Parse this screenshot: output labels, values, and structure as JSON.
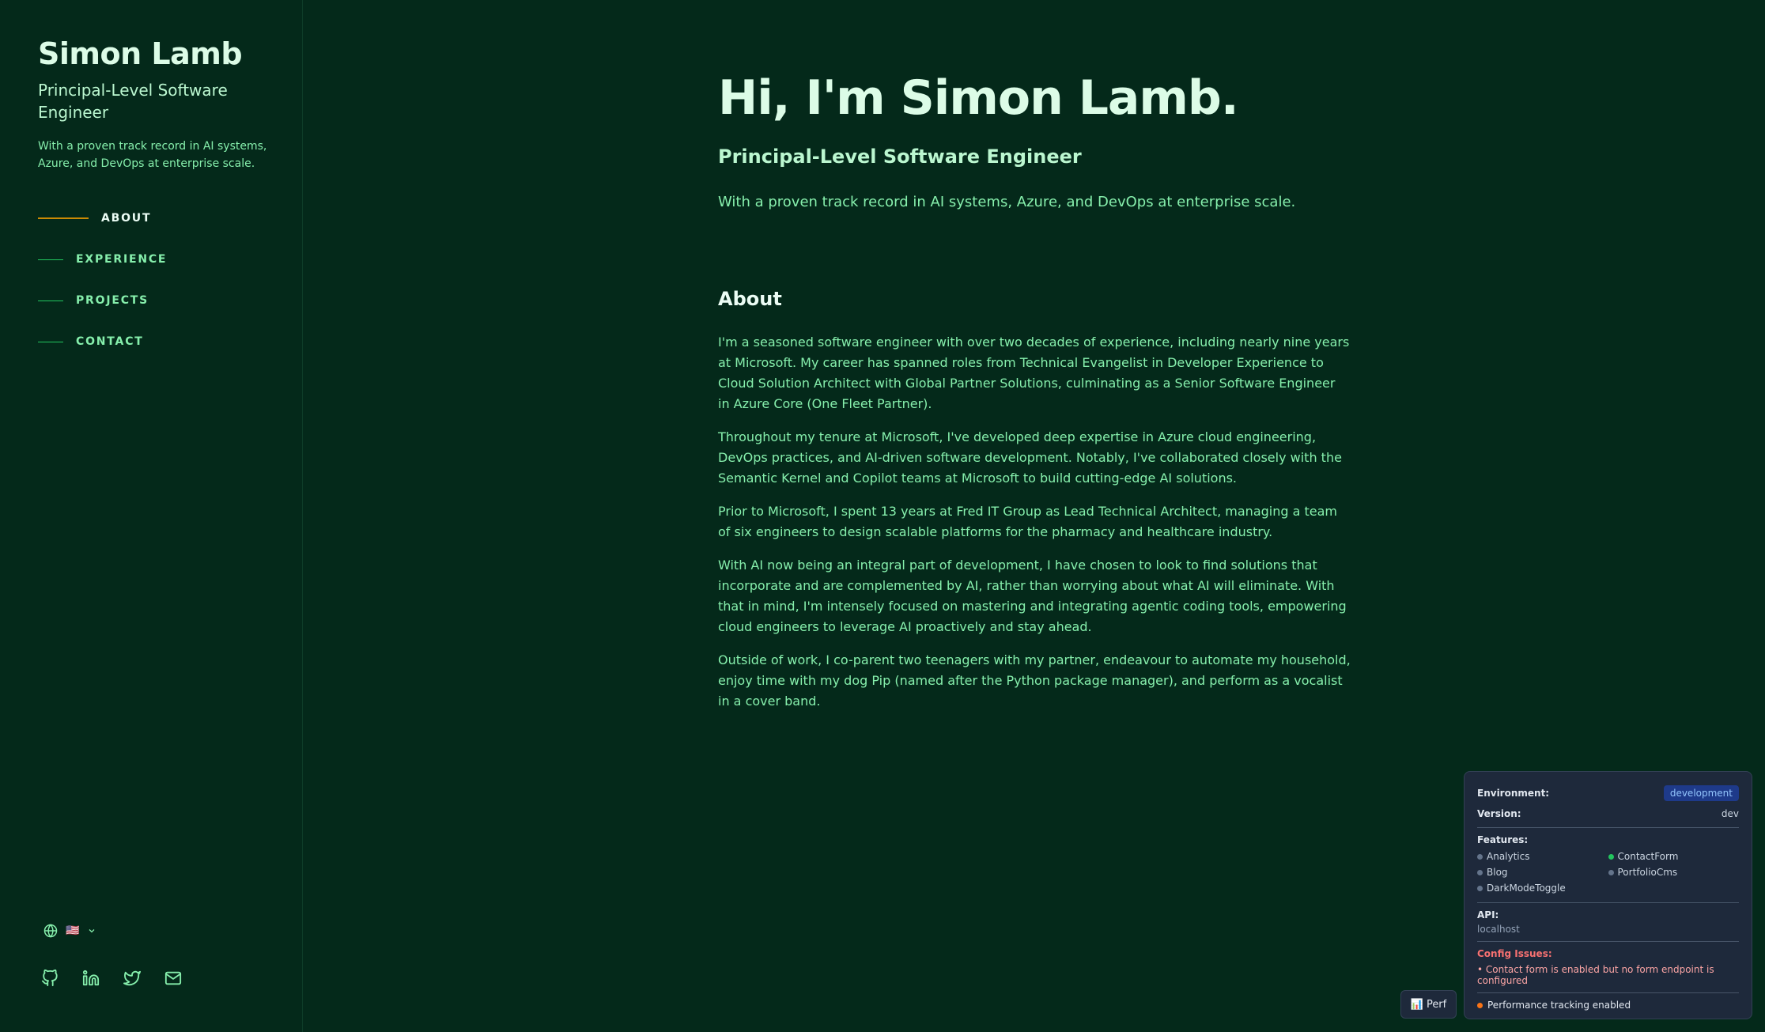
{
  "sidebar": {
    "name": "Simon Lamb",
    "title": "Principal-Level Software Engineer",
    "tagline": "With a proven track record in AI systems, Azure, and DevOps at enterprise scale.",
    "nav": [
      {
        "label": "ABOUT",
        "active": true
      },
      {
        "label": "EXPERIENCE",
        "active": false
      },
      {
        "label": "PROJECTS",
        "active": false
      },
      {
        "label": "CONTACT",
        "active": false
      }
    ],
    "language": {
      "icon": "globe-icon",
      "flag": "🇺🇸",
      "chevron": "chevron-down-icon"
    },
    "socials": [
      "github-icon",
      "linkedin-icon",
      "twitter-icon",
      "mail-icon"
    ]
  },
  "hero": {
    "title": "Hi, I'm Simon Lamb.",
    "subtitle": "Principal-Level Software Engineer",
    "tagline": "With a proven track record in AI systems, Azure, and DevOps at enterprise scale."
  },
  "about": {
    "heading": "About",
    "paragraphs": [
      "I'm a seasoned software engineer with over two decades of experience, including nearly nine years at Microsoft. My career has spanned roles from Technical Evangelist in Developer Experience to Cloud Solution Architect with Global Partner Solutions, culminating as a Senior Software Engineer in Azure Core (One Fleet Partner).",
      "Throughout my tenure at Microsoft, I've developed deep expertise in Azure cloud engineering, DevOps practices, and AI-driven software development. Notably, I've collaborated closely with the Semantic Kernel and Copilot teams at Microsoft to build cutting-edge AI solutions.",
      "Prior to Microsoft, I spent 13 years at Fred IT Group as Lead Technical Architect, managing a team of six engineers to design scalable platforms for the pharmacy and healthcare industry.",
      "With AI now being an integral part of development, I have chosen to look to find solutions that incorporate and are complemented by AI, rather than worrying about what AI will eliminate. With that in mind, I'm intensely focused on mastering and integrating agentic coding tools, empowering cloud engineers to leverage AI proactively and stay ahead.",
      "Outside of work, I co-parent two teenagers with my partner, endeavour to automate my household, enjoy time with my dog Pip (named after the Python package manager), and perform as a vocalist in a cover band."
    ]
  },
  "devpanel": {
    "env_label": "Environment:",
    "env_value": "development",
    "version_label": "Version:",
    "version_value": "dev",
    "features_label": "Features:",
    "features": [
      {
        "name": "Analytics",
        "enabled": false
      },
      {
        "name": "ContactForm",
        "enabled": true
      },
      {
        "name": "Blog",
        "enabled": false
      },
      {
        "name": "PortfolioCms",
        "enabled": false
      },
      {
        "name": "DarkModeToggle",
        "enabled": false
      }
    ],
    "api_label": "API:",
    "api_value": "localhost",
    "config_label": "Config Issues:",
    "config_issue": "• Contact form is enabled but no form endpoint is configured",
    "perf_tracking": "Performance tracking enabled"
  },
  "perf_button": {
    "icon": "📊",
    "label": "Perf"
  },
  "colors": {
    "background": "#04291a",
    "accent_active": "#ca8a04",
    "text_primary": "#dcfce7",
    "text_secondary": "#86efac",
    "panel_bg": "#1e293b"
  }
}
